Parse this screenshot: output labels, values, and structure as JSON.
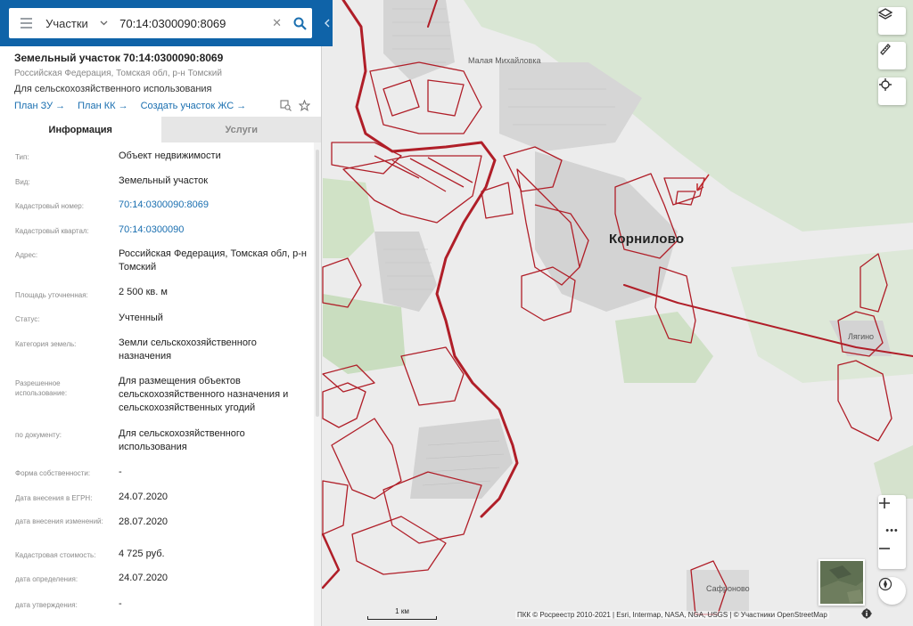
{
  "search": {
    "category": "Участки",
    "value": "70:14:0300090:8069",
    "clear_icon": "close-icon",
    "search_icon": "search-icon"
  },
  "header": {
    "title": "Земельный участок 70:14:0300090:8069",
    "address": "Российская Федерация, Томская обл, р-н Томский",
    "use": "Для сельскохозяйственного использования",
    "links": [
      "План ЗУ →",
      "План КК →",
      "Создать участок ЖС →"
    ]
  },
  "tabs": [
    {
      "label": "Информация",
      "active": true
    },
    {
      "label": "Услуги",
      "active": false
    }
  ],
  "details": [
    {
      "label": "Тип:",
      "value": "Объект недвижимости"
    },
    {
      "label": "Вид:",
      "value": "Земельный участок"
    },
    {
      "label": "Кадастровый номер:",
      "value": "70:14:0300090:8069",
      "link": true
    },
    {
      "label": "Кадастровый квартал:",
      "value": "70:14:0300090",
      "link": true
    },
    {
      "label": "Адрес:",
      "value": "Российская Федерация, Томская обл, р-н Томский"
    },
    {
      "label": "Площадь уточненная:",
      "value": "2 500 кв. м"
    },
    {
      "label": "Статус:",
      "value": "Учтенный"
    },
    {
      "label": "Категория земель:",
      "value": "Земли сельскохозяйственного назначения"
    },
    {
      "label": "Разрешенное использование:",
      "value": "Для размещения объектов сельскохозяйственного назначения и сельскохозяйственных угодий"
    },
    {
      "label": "по документу:",
      "value": "Для сельскохозяйственного использования"
    },
    {
      "label": "Форма собственности:",
      "value": "-"
    },
    {
      "label": "Дата внесения в ЕГРН:",
      "value": "24.07.2020"
    },
    {
      "label": "дата внесения изменений:",
      "value": "28.07.2020"
    },
    {
      "label": "Кадастровая стоимость:",
      "value": "4 725 руб."
    },
    {
      "label": "дата определения:",
      "value": "24.07.2020"
    },
    {
      "label": "дата утверждения:",
      "value": "-"
    }
  ],
  "map": {
    "places": {
      "malaya_mikhailovka": "Малая Михайловка",
      "kornilovo": "Корнилово",
      "lyagino": "Лягино",
      "safronovo": "Сафроново"
    },
    "scale_label": "1 км",
    "attribution": "ПКК © Росреестр 2010-2021 | Esri, Intermap, NASA, NGA, USGS | © Участники OpenStreetMap",
    "colors": {
      "parcel": "#b01e28",
      "base": "#ececec",
      "forest": "#d6e3cf",
      "built": "#d3d3d3",
      "panel_header": "#0f63a8"
    }
  }
}
